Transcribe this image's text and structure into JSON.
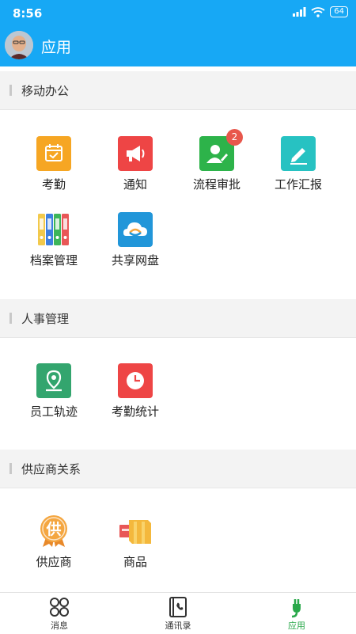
{
  "status_bar": {
    "time": "8:56",
    "battery": "64"
  },
  "header": {
    "title": "应用"
  },
  "sections": [
    {
      "title": "移动办公",
      "items": [
        {
          "label": "考勤",
          "icon": "calendar-icon",
          "color": "#f6a623"
        },
        {
          "label": "通知",
          "icon": "megaphone-icon",
          "color": "#ee4545"
        },
        {
          "label": "流程审批",
          "icon": "user-edit-icon",
          "color": "#2db34a",
          "badge": "2"
        },
        {
          "label": "工作汇报",
          "icon": "pen-icon",
          "color": "#27c2c2"
        },
        {
          "label": "档案管理",
          "icon": "binders-icon",
          "color": "#f2c94c"
        },
        {
          "label": "共享网盘",
          "icon": "cloud-icon",
          "color": "#2196d9"
        }
      ]
    },
    {
      "title": "人事管理",
      "items": [
        {
          "label": "员工轨迹",
          "icon": "location-pin-icon",
          "color": "#33a56e"
        },
        {
          "label": "考勤统计",
          "icon": "clock-icon",
          "color": "#ee4545"
        }
      ]
    },
    {
      "title": "供应商关系",
      "items": [
        {
          "label": "供应商",
          "icon": "supplier-medal-icon",
          "color": "#f4a640",
          "icon_text": "供"
        },
        {
          "label": "商品",
          "icon": "goods-boxes-icon",
          "color": "#f4b83c"
        }
      ]
    }
  ],
  "tabbar": {
    "tabs": [
      {
        "label": "消息",
        "icon": "circles-grid-icon"
      },
      {
        "label": "通讯录",
        "icon": "contacts-book-icon"
      },
      {
        "label": "应用",
        "icon": "plug-icon",
        "active": true
      }
    ],
    "active_color": "#29a84a"
  }
}
